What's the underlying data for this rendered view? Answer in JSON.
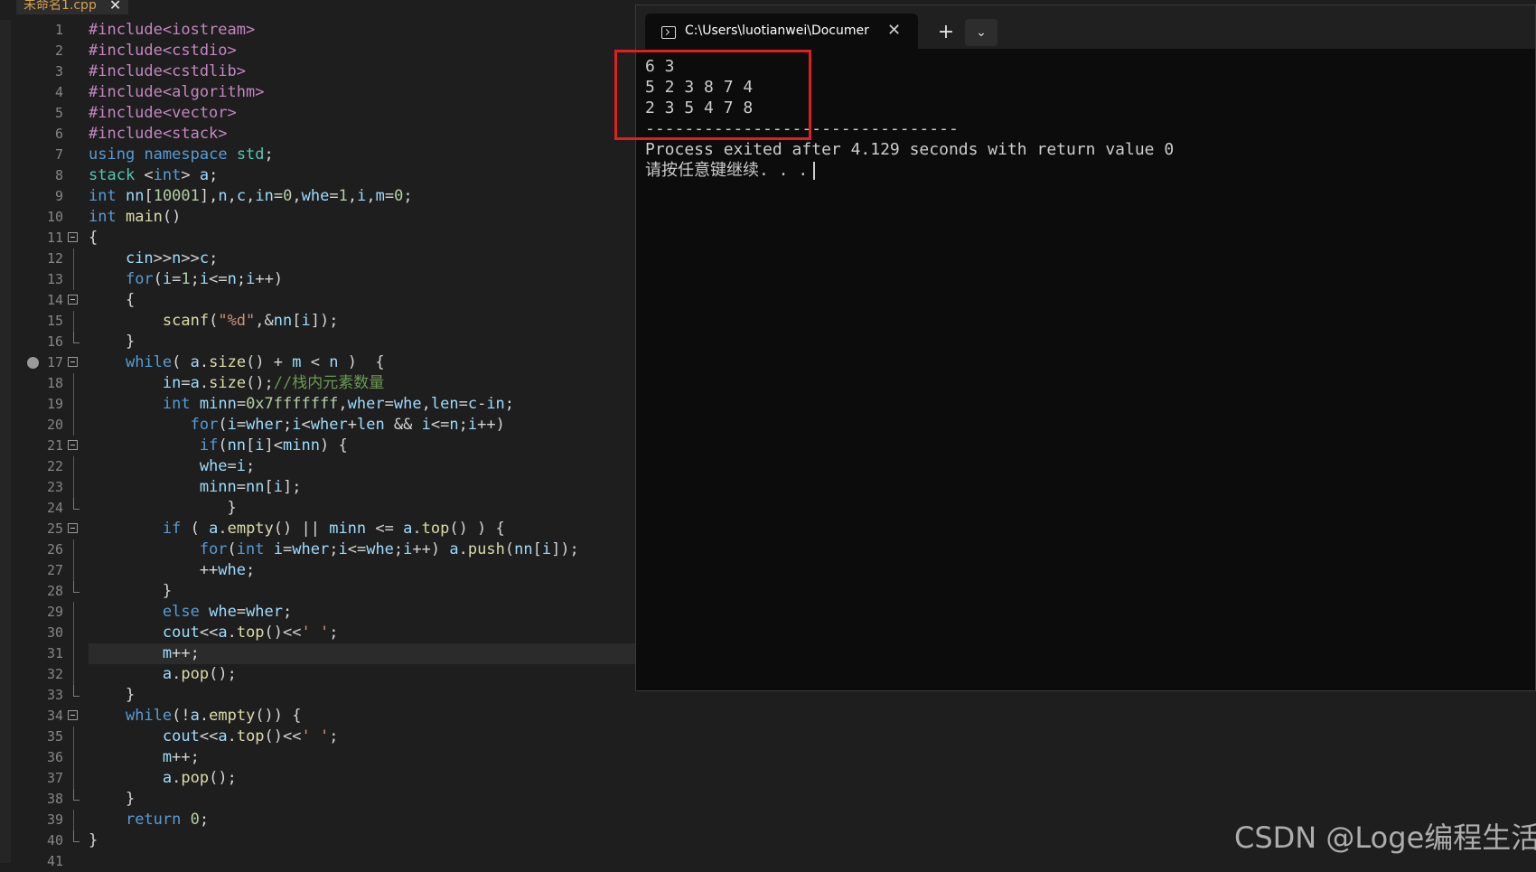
{
  "editor": {
    "tab_title": "未命名1.cpp",
    "tab_close": "✕",
    "breakpoint_line": 17,
    "current_line": 31,
    "lines": [
      {
        "n": "1",
        "text": "#include<iostream>"
      },
      {
        "n": "2",
        "text": "#include<cstdio>"
      },
      {
        "n": "3",
        "text": "#include<cstdlib>"
      },
      {
        "n": "4",
        "text": "#include<algorithm>"
      },
      {
        "n": "5",
        "text": "#include<vector>"
      },
      {
        "n": "6",
        "text": "#include<stack>"
      },
      {
        "n": "7",
        "text": "using namespace std;"
      },
      {
        "n": "8",
        "text": "stack <int> a;"
      },
      {
        "n": "9",
        "text": "int nn[10001],n,c,in=0,whe=1,i,m=0;"
      },
      {
        "n": "10",
        "text": "int main()"
      },
      {
        "n": "11",
        "text": "{"
      },
      {
        "n": "12",
        "text": "    cin>>n>>c;"
      },
      {
        "n": "13",
        "text": "    for(i=1;i<=n;i++)"
      },
      {
        "n": "14",
        "text": "    {"
      },
      {
        "n": "15",
        "text": "        scanf(\"%d\",&nn[i]);"
      },
      {
        "n": "16",
        "text": "    }"
      },
      {
        "n": "17",
        "text": "    while( a.size() + m < n )  {"
      },
      {
        "n": "18",
        "text": "        in=a.size();//栈内元素数量"
      },
      {
        "n": "19",
        "text": "        int minn=0x7fffffff,wher=whe,len=c-in;"
      },
      {
        "n": "20",
        "text": "           for(i=wher;i<wher+len && i<=n;i++)"
      },
      {
        "n": "21",
        "text": "            if(nn[i]<minn) {"
      },
      {
        "n": "22",
        "text": "            whe=i;"
      },
      {
        "n": "23",
        "text": "            minn=nn[i];"
      },
      {
        "n": "24",
        "text": "               }"
      },
      {
        "n": "25",
        "text": "        if ( a.empty() || minn <= a.top() ) {"
      },
      {
        "n": "26",
        "text": "            for(int i=wher;i<=whe;i++) a.push(nn[i]);"
      },
      {
        "n": "27",
        "text": "            ++whe;"
      },
      {
        "n": "28",
        "text": "        }"
      },
      {
        "n": "29",
        "text": "        else whe=wher;"
      },
      {
        "n": "30",
        "text": "        cout<<a.top()<<' ';"
      },
      {
        "n": "31",
        "text": "        m++;"
      },
      {
        "n": "32",
        "text": "        a.pop();"
      },
      {
        "n": "33",
        "text": "    }"
      },
      {
        "n": "34",
        "text": "    while(!a.empty()) {"
      },
      {
        "n": "35",
        "text": "        cout<<a.top()<<' ';"
      },
      {
        "n": "36",
        "text": "        m++;"
      },
      {
        "n": "37",
        "text": "        a.pop();"
      },
      {
        "n": "38",
        "text": "    }"
      },
      {
        "n": "39",
        "text": "    return 0;"
      },
      {
        "n": "40",
        "text": "}"
      },
      {
        "n": "41",
        "text": ""
      }
    ]
  },
  "terminal": {
    "title": "C:\\Users\\luotianwei\\Documer",
    "close_label": "✕",
    "new_tab_label": "+",
    "dropdown_label": "⌄",
    "lines": [
      "6 3",
      "5 2 3 8 7 4",
      "2 3 5 4 7 8",
      "--------------------------------",
      "Process exited after 4.129 seconds with return value 0",
      "请按任意键继续. . ."
    ]
  },
  "watermark": "CSDN @Loge编程生活"
}
